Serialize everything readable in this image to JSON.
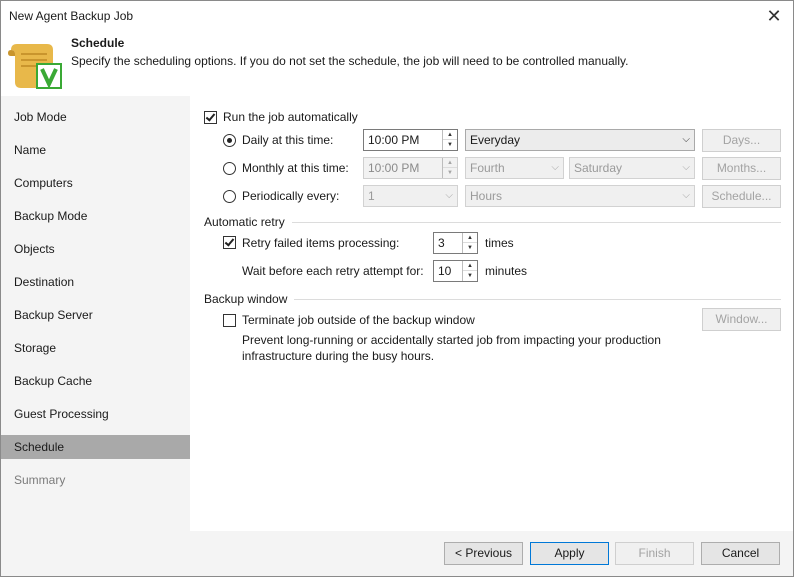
{
  "window": {
    "title": "New Agent Backup Job"
  },
  "header": {
    "title": "Schedule",
    "description": "Specify the scheduling options. If you do not set the schedule, the job will need to be controlled manually."
  },
  "sidebar": {
    "items": [
      {
        "label": "Job Mode"
      },
      {
        "label": "Name"
      },
      {
        "label": "Computers"
      },
      {
        "label": "Backup Mode"
      },
      {
        "label": "Objects"
      },
      {
        "label": "Destination"
      },
      {
        "label": "Backup Server"
      },
      {
        "label": "Storage"
      },
      {
        "label": "Backup Cache"
      },
      {
        "label": "Guest Processing"
      },
      {
        "label": "Schedule"
      },
      {
        "label": "Summary"
      }
    ]
  },
  "schedule": {
    "run_automatically_label": "Run the job automatically",
    "daily_label": "Daily at this time:",
    "daily_time": "10:00 PM",
    "daily_select": "Everyday",
    "days_button": "Days...",
    "monthly_label": "Monthly at this time:",
    "monthly_time": "10:00 PM",
    "monthly_week": "Fourth",
    "monthly_day": "Saturday",
    "months_button": "Months...",
    "periodically_label": "Periodically every:",
    "periodically_value": "1",
    "periodically_unit": "Hours",
    "schedule_button": "Schedule..."
  },
  "retry": {
    "section_title": "Automatic retry",
    "retry_label": "Retry failed items processing:",
    "retry_count": "3",
    "retry_unit": "times",
    "wait_label": "Wait before each retry attempt for:",
    "wait_value": "10",
    "wait_unit": "minutes"
  },
  "backup_window": {
    "section_title": "Backup window",
    "terminate_label": "Terminate job outside of the backup window",
    "window_button": "Window...",
    "note_line1": "Prevent long-running or accidentally started job from impacting your production",
    "note_line2": "infrastructure during the busy hours."
  },
  "footer": {
    "previous_label": "< Previous",
    "apply_label": "Apply",
    "finish_label": "Finish",
    "cancel_label": "Cancel"
  },
  "icons": {
    "close": "close-icon",
    "header": "schedule-scroll-icon",
    "accent_check_color": "#3aa935",
    "scroll_color": "#e8b84a"
  }
}
